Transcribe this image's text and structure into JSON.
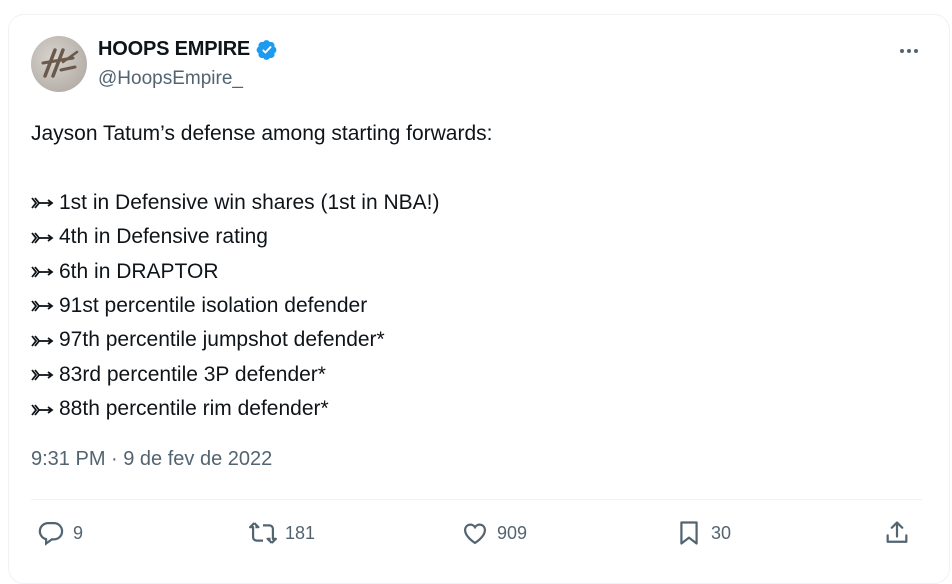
{
  "author": {
    "display_name": "HOOPS EMPIRE",
    "handle": "@HoopsEmpire_",
    "verified": true
  },
  "tweet": {
    "intro": "Jayson Tatum’s defense among starting forwards:",
    "items": [
      "1st in Defensive win shares (1st in NBA!)",
      "4th in Defensive rating",
      "6th in DRAPTOR",
      "91st percentile isolation defender",
      "97th percentile jumpshot defender*",
      "83rd percentile 3P defender*",
      "88th percentile rim defender*"
    ],
    "timestamp": "9:31 PM · 9 de fev de 2022"
  },
  "actions": {
    "replies": "9",
    "retweets": "181",
    "likes": "909",
    "bookmarks": "30"
  },
  "icons": {
    "verified": "verified-badge-icon",
    "more": "more-dots-icon",
    "bullet": "arrow-right-icon",
    "reply": "reply-icon",
    "retweet": "retweet-icon",
    "like": "heart-icon",
    "bookmark": "bookmark-icon",
    "share": "share-icon"
  },
  "colors": {
    "verified": "#1d9bf0",
    "text": "#0f1419",
    "secondary": "#536471",
    "border": "#eff3f4"
  }
}
